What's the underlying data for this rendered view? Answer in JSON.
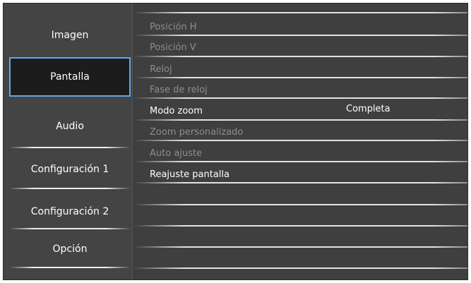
{
  "sidebar": {
    "items": [
      {
        "label": "Imagen"
      },
      {
        "label": "Pantalla"
      },
      {
        "label": "Audio"
      },
      {
        "label": "Configuración 1"
      },
      {
        "label": "Configuración 2"
      },
      {
        "label": "Opción"
      }
    ],
    "selected_index": 1
  },
  "panel": {
    "rows": [
      {
        "label": "Posición H",
        "value": "",
        "enabled": false
      },
      {
        "label": "Posición V",
        "value": "",
        "enabled": false
      },
      {
        "label": "Reloj",
        "value": "",
        "enabled": false
      },
      {
        "label": "Fase de reloj",
        "value": "",
        "enabled": false
      },
      {
        "label": "Modo zoom",
        "value": "Completa",
        "enabled": true
      },
      {
        "label": "Zoom personalizado",
        "value": "",
        "enabled": false
      },
      {
        "label": "Auto ajuste",
        "value": "",
        "enabled": false
      },
      {
        "label": "Reajuste pantalla",
        "value": "",
        "enabled": true
      }
    ]
  },
  "colors": {
    "accent_border": "#6aa7d8",
    "enabled_text": "#ffffff",
    "disabled_text": "#8d8d8d"
  }
}
